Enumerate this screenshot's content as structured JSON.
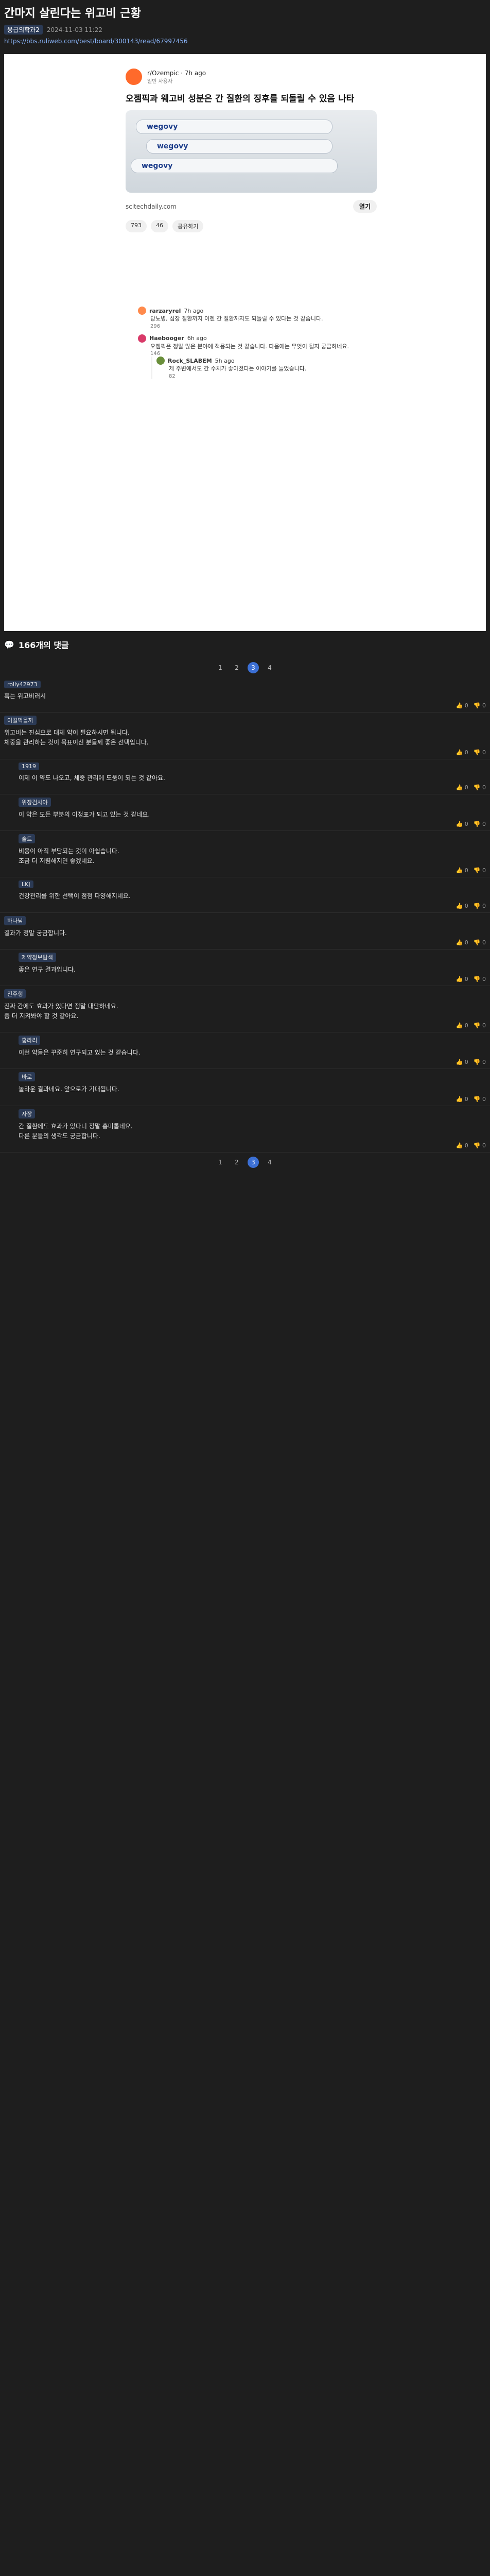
{
  "post": {
    "title": "간마지 살린다는 위고비 근황",
    "author": "응급의학과2",
    "time": "2024-11-03 11:22",
    "url": "https://bbs.ruliweb.com/best/board/300143/read/67997456"
  },
  "embed": {
    "subreddit": "r/Ozempic · 7h ago",
    "source": "일반 사용자",
    "title": "오젬픽과 웨고비 성분은 간 질환의 징후를 되돌릴 수 있음 나타",
    "site": "scitechdaily.com",
    "open_label": "열기",
    "chips": [
      "793",
      "46",
      "공유하기"
    ],
    "pen_label": "wegovy"
  },
  "reddit_comments": [
    {
      "user": "rarzaryrel",
      "time": "7h ago",
      "body": "당뇨병, 심장 질환까지 이젠 간 질환까지도 되돌릴 수 있다는 것 같습니다.",
      "votes": "296"
    },
    {
      "user": "Haebooger",
      "time": "6h ago",
      "body": "오젬픽은 정말 많은 분야에 적용되는 것 같습니다. 다음에는 무엇이 될지 궁금하네요.",
      "votes": "146"
    },
    {
      "user": "Rock_SLABEM",
      "time": "5h ago",
      "body": "제 주변에서도 간 수치가 좋아졌다는 이야기를 들었습니다.",
      "votes": "82"
    }
  ],
  "comments_section": {
    "count_label": "166개의 댓글",
    "pages": [
      "1",
      "2",
      "3",
      "4"
    ],
    "active_page": "3"
  },
  "comments": [
    {
      "nick": "rolly42973",
      "body": "혹는 위고비러시",
      "up": "0",
      "down": "0",
      "reply": false
    },
    {
      "nick": "이걸먹을까",
      "body": "위고비는 진심으로 대체 약이 필요하시면 됩니다.\n체중을 관리하는 것이 목표이신 분들께 좋은 선택입니다.",
      "up": "0",
      "down": "0",
      "reply": false
    },
    {
      "nick": "1919",
      "body": "이제 이 약도 나오고, 체중 관리에 도움이 되는 것 같아요.",
      "up": "0",
      "down": "0",
      "reply": true
    },
    {
      "nick": "위장검사야",
      "body": "이 약은 모든 부분의 이정표가 되고 있는 것 같네요.",
      "up": "0",
      "down": "0",
      "reply": true
    },
    {
      "nick": "솔트",
      "body": "비용이 아직 부담되는 것이 아쉽습니다.\n조금 더 저렴해지면 좋겠네요.",
      "up": "0",
      "down": "0",
      "reply": true
    },
    {
      "nick": "LKJ",
      "body": "건강관리를 위한 선택이 점점 다양해지네요.",
      "up": "0",
      "down": "0",
      "reply": true
    },
    {
      "nick": "하나님",
      "body": "결과가 정말 궁금합니다.",
      "up": "0",
      "down": "0",
      "reply": false
    },
    {
      "nick": "제약정보탐색",
      "body": "좋은 연구 결과입니다.",
      "up": "0",
      "down": "0",
      "reply": true
    },
    {
      "nick": "진주행",
      "body": "진짜 간에도 효과가 있다면 정말 대단하네요.\n좀 더 지켜봐야 할 것 같아요.",
      "up": "0",
      "down": "0",
      "reply": false
    },
    {
      "nick": "홍라리",
      "body": "이런 약들은 꾸준히 연구되고 있는 것 같습니다.",
      "up": "0",
      "down": "0",
      "reply": true
    },
    {
      "nick": "바로",
      "body": "놀라운 결과네요. 앞으로가 기대됩니다.",
      "up": "0",
      "down": "0",
      "reply": true
    },
    {
      "nick": "자장",
      "body": "간 질환에도 효과가 있다니 정말 흥미롭네요.\n다른 분들의 생각도 궁금합니다.",
      "up": "0",
      "down": "0",
      "reply": true
    }
  ]
}
